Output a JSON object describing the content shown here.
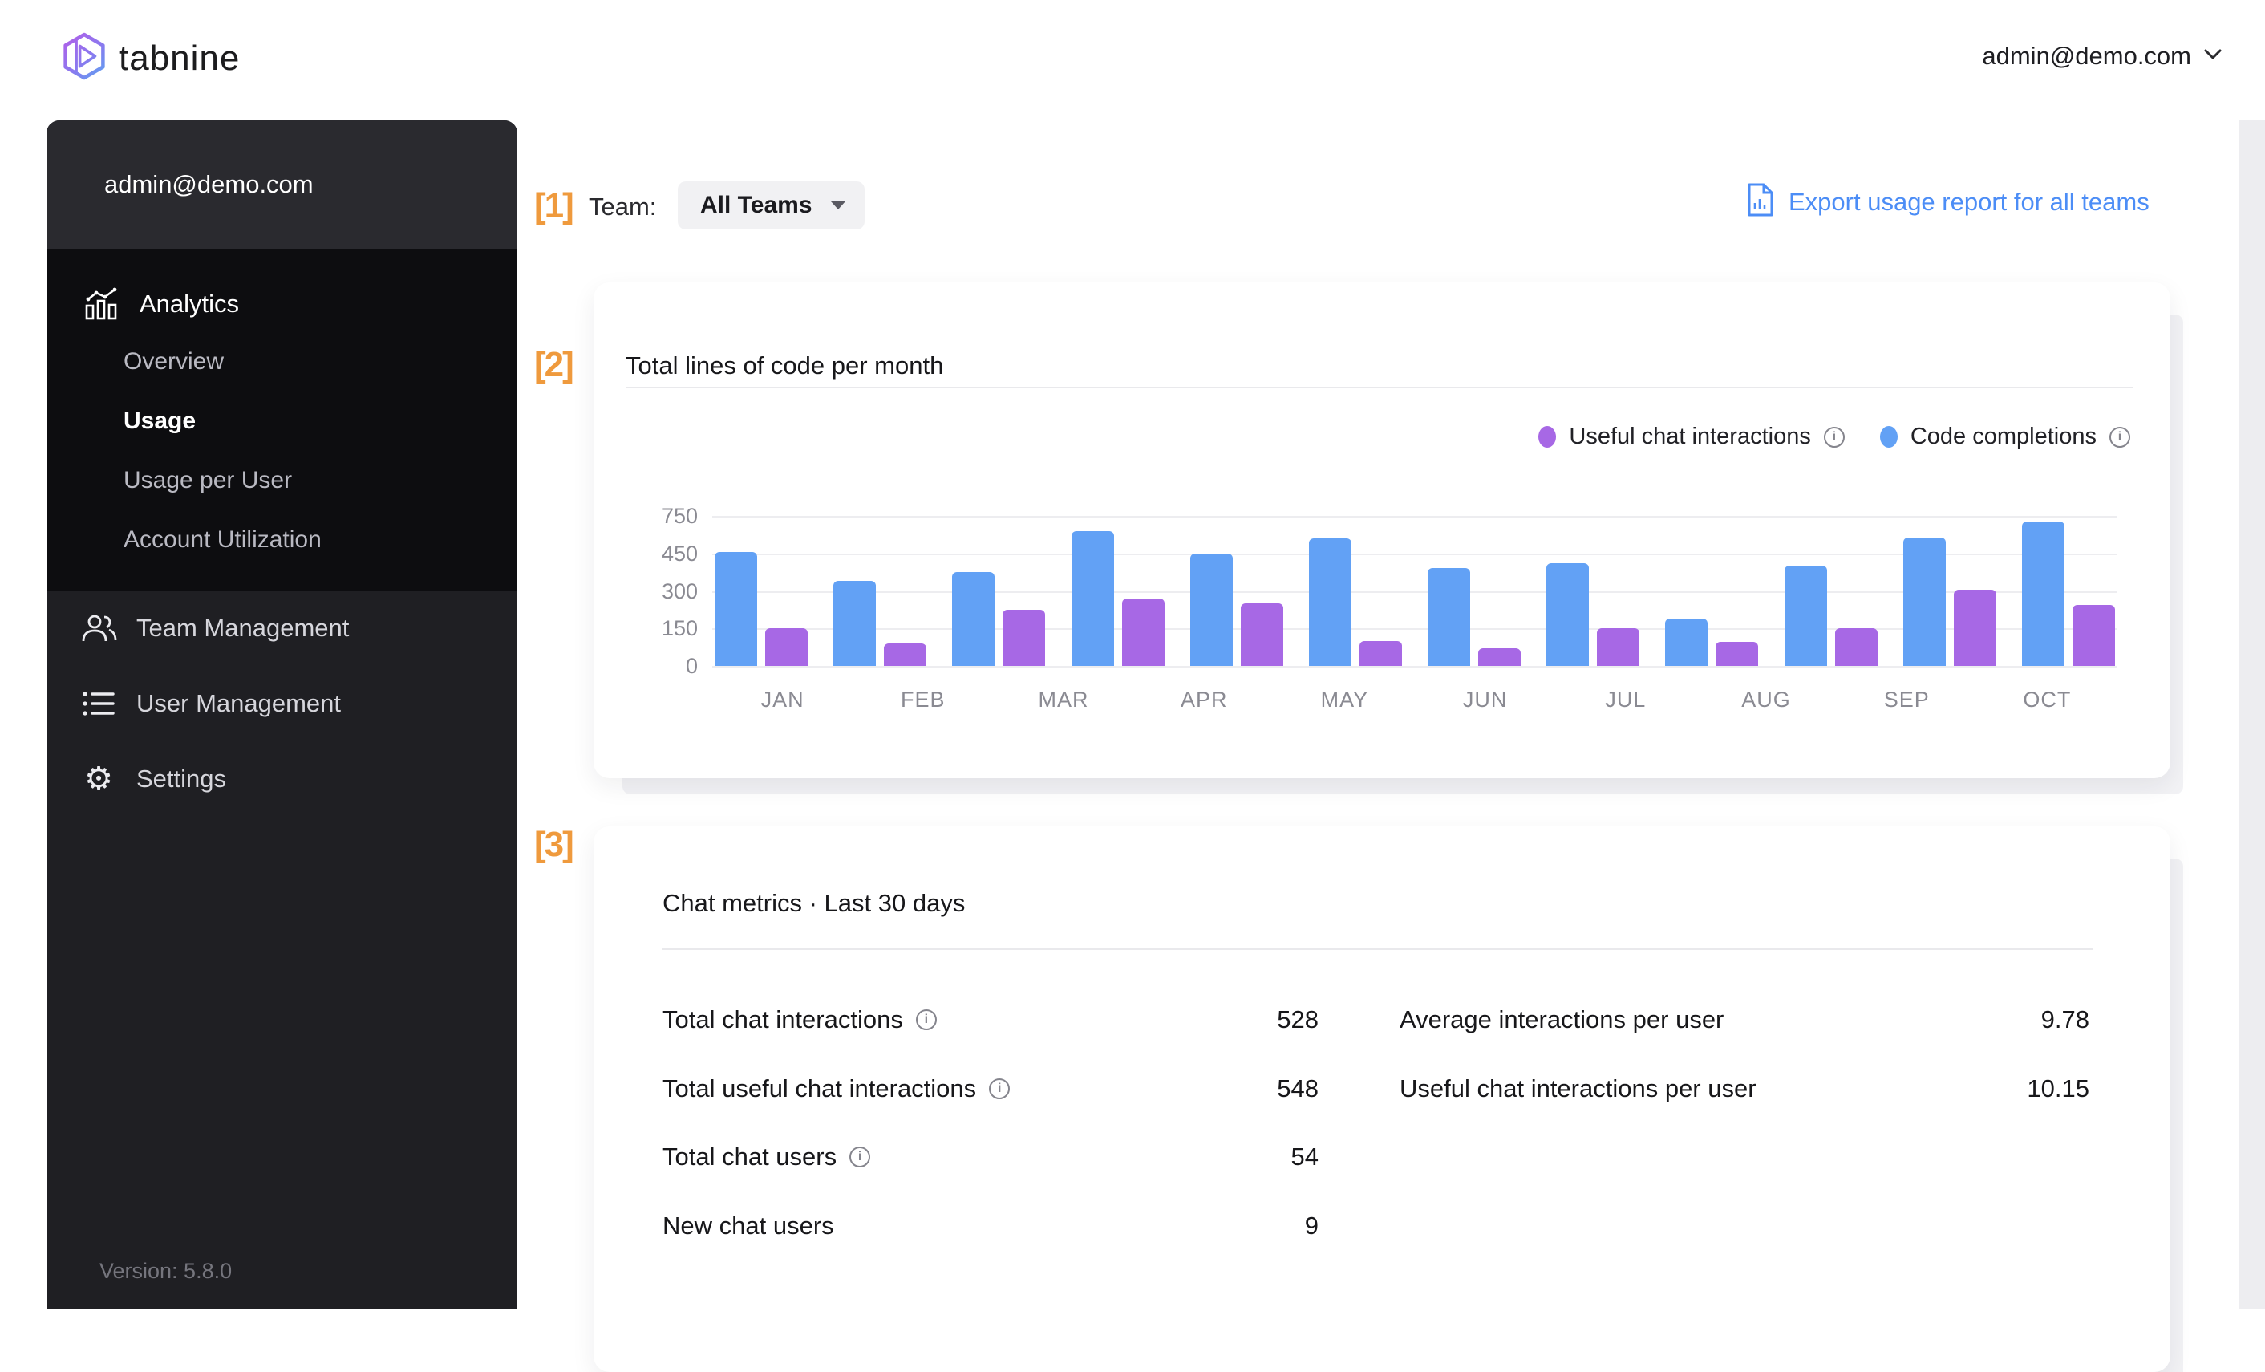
{
  "topbar": {
    "brand": "tabnine",
    "account_label": "admin@demo.com"
  },
  "sidebar": {
    "email": "admin@demo.com",
    "analytics_label": "Analytics",
    "analytics_items": [
      {
        "label": "Overview"
      },
      {
        "label": "Usage"
      },
      {
        "label": "Usage per User"
      },
      {
        "label": "Account Utilization"
      }
    ],
    "nav_items": [
      {
        "label": "Team Management"
      },
      {
        "label": "User Management"
      },
      {
        "label": "Settings"
      }
    ],
    "version": "Version: 5.8.0"
  },
  "annotations": {
    "m1": "[1]",
    "m2": "[2]",
    "m3": "[3]",
    "color": "#EF9A3D"
  },
  "toolbar": {
    "team_label": "Team:",
    "team_value": "All Teams",
    "export_label": "Export usage report for all teams",
    "link_color": "#4C8DF6"
  },
  "chart_card": {
    "title": "Total lines of code per month",
    "legend": [
      {
        "label": "Useful chat interactions",
        "color": "#A768E5"
      },
      {
        "label": "Code completions",
        "color": "#62A1F5"
      }
    ]
  },
  "chart_data": {
    "type": "bar",
    "title": "Total lines of code per month",
    "categories": [
      "JAN",
      "FEB",
      "MAR",
      "APR",
      "MAY",
      "JUN",
      "JUL",
      "AUG",
      "SEP",
      "OCT"
    ],
    "y_ticks": [
      750,
      450,
      300,
      150,
      0
    ],
    "y_scale_note": "tick labels 0,150,300,450,750 are equally spaced on the axis (non-linear top segment)",
    "grid": true,
    "legend_position": "top-right",
    "series": [
      {
        "name": "Code completions",
        "color": "#62A1F5",
        "values": [
          460,
          340,
          375,
          630,
          450,
          570,
          390,
          410,
          190,
          400,
          580,
          705
        ]
      },
      {
        "name": "Useful chat interactions",
        "color": "#A768E5",
        "values": [
          150,
          90,
          225,
          270,
          250,
          100,
          70,
          150,
          95,
          150,
          305,
          245
        ]
      }
    ]
  },
  "metrics_card": {
    "title": "Chat metrics · Last 30 days",
    "left_rows": [
      {
        "label": "Total chat interactions",
        "info": true,
        "value": "528"
      },
      {
        "label": "Total useful chat interactions",
        "info": true,
        "value": "548"
      },
      {
        "label": "Total chat users",
        "info": true,
        "value": "54"
      },
      {
        "label": "New chat users",
        "info": false,
        "value": "9"
      }
    ],
    "right_rows": [
      {
        "label": "Average interactions per user",
        "value": "9.78"
      },
      {
        "label": "Useful chat interactions per user",
        "value": "10.15"
      }
    ]
  }
}
